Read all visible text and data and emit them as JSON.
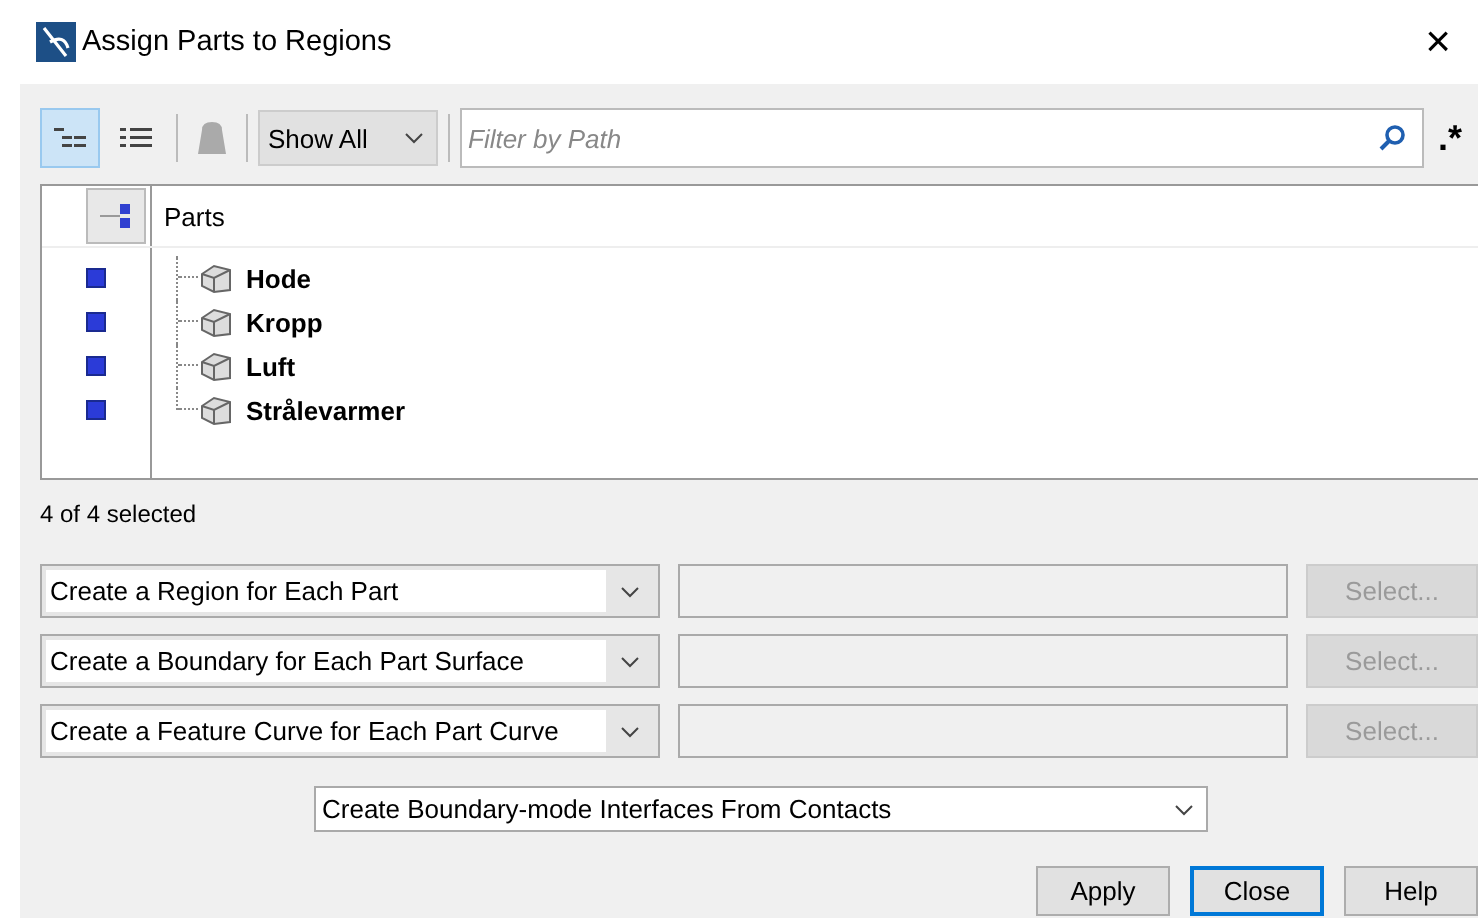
{
  "window": {
    "title": "Assign Parts to Regions",
    "close": "×"
  },
  "toolbar": {
    "views": [
      {
        "kind": "tree",
        "selected": true
      },
      {
        "kind": "list",
        "selected": false
      }
    ],
    "show": "Show All",
    "filter": {
      "placeholder": "Filter by Path"
    },
    "regex": ".*"
  },
  "table": {
    "column": "Parts",
    "rows": [
      {
        "name": "Hode",
        "selected": true
      },
      {
        "name": "Kropp",
        "selected": true
      },
      {
        "name": "Luft",
        "selected": true
      },
      {
        "name": "Strålevarmer",
        "selected": true
      }
    ]
  },
  "status": "4 of 4 selected",
  "options": [
    {
      "mode": "Create a Region for Each Part",
      "select": "Select...",
      "disabled": true
    },
    {
      "mode": "Create a Boundary for Each Part Surface",
      "select": "Select...",
      "disabled": true
    },
    {
      "mode": "Create a Feature Curve for Each Part Curve",
      "select": "Select...",
      "disabled": true
    }
  ],
  "interfaces": "Create Boundary-mode Interfaces From Contacts",
  "buttons": [
    {
      "label": "Apply",
      "default": false
    },
    {
      "label": "Close",
      "default": true
    },
    {
      "label": "Help",
      "default": false
    }
  ]
}
